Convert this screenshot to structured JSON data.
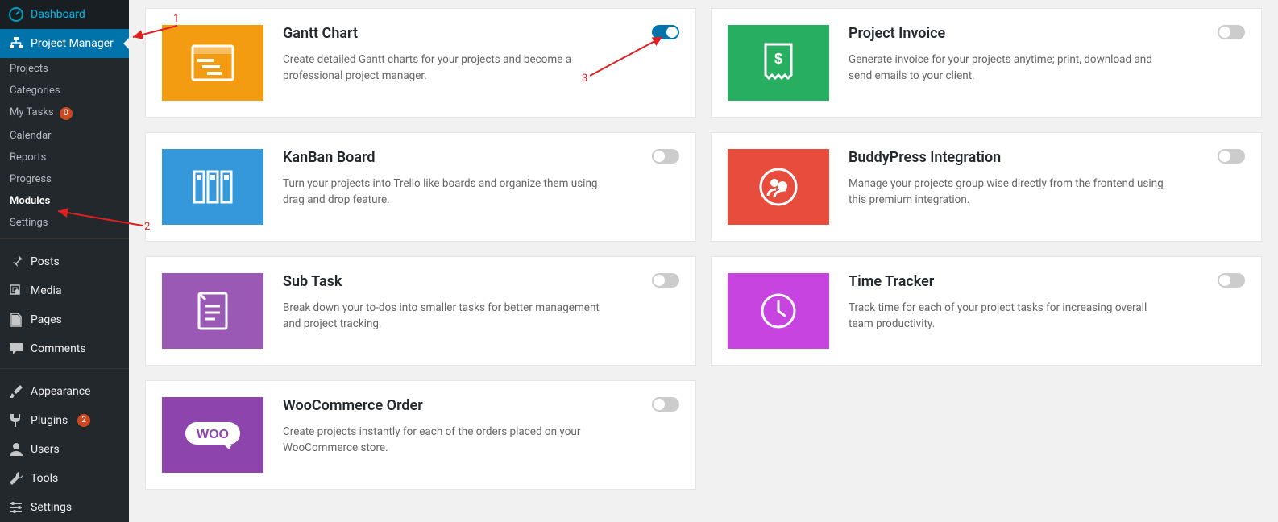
{
  "sidebar": {
    "dashboard": "Dashboard",
    "project_manager": "Project Manager",
    "submenu": {
      "projects": "Projects",
      "categories": "Categories",
      "my_tasks": "My Tasks",
      "my_tasks_count": "0",
      "calendar": "Calendar",
      "reports": "Reports",
      "progress": "Progress",
      "modules": "Modules",
      "settings": "Settings"
    },
    "posts": "Posts",
    "media": "Media",
    "pages": "Pages",
    "comments": "Comments",
    "appearance": "Appearance",
    "plugins": "Plugins",
    "plugins_count": "2",
    "users": "Users",
    "tools": "Tools",
    "wp_settings": "Settings"
  },
  "modules": {
    "gantt": {
      "title": "Gantt Chart",
      "desc": "Create detailed Gantt charts for your projects and become a professional project manager.",
      "enabled": true
    },
    "kanban": {
      "title": "KanBan Board",
      "desc": "Turn your projects into Trello like boards and organize them using drag and drop feature.",
      "enabled": false
    },
    "subtask": {
      "title": "Sub Task",
      "desc": "Break down your to-dos into smaller tasks for better management and project tracking.",
      "enabled": false
    },
    "woo": {
      "title": "WooCommerce Order",
      "desc": "Create projects instantly for each of the orders placed on your WooCommerce store.",
      "enabled": false
    },
    "invoice": {
      "title": "Project Invoice",
      "desc": "Generate invoice for your projects anytime; print, download and send emails to your client.",
      "enabled": false
    },
    "buddypress": {
      "title": "BuddyPress Integration",
      "desc": "Manage your projects group wise directly from the frontend using this premium integration.",
      "enabled": false
    },
    "timetracker": {
      "title": "Time Tracker",
      "desc": "Track time for each of your project tasks for increasing overall team productivity.",
      "enabled": false
    }
  },
  "annotations": {
    "a1": "1",
    "a2": "2",
    "a3": "3"
  }
}
